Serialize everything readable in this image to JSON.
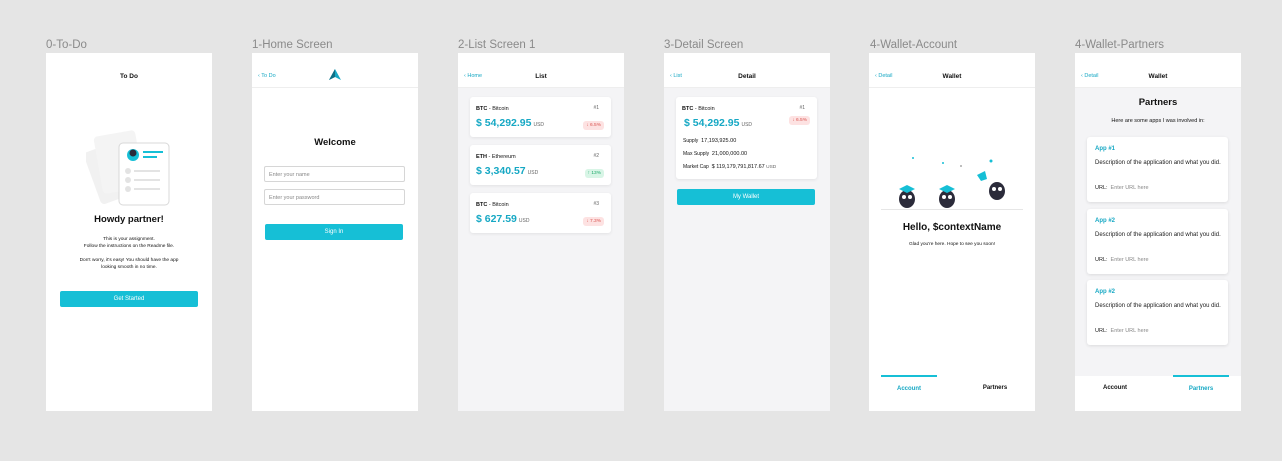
{
  "frames": [
    "0-To-Do",
    "1-Home Screen",
    "2-List Screen 1",
    "3-Detail Screen",
    "4-Wallet-Account",
    "4-Wallet-Partners"
  ],
  "todo": {
    "title": "To Do",
    "heading": "Howdy partner!",
    "line1": "This is your assignment.",
    "line2": "Follow the instructions on the Readme file.",
    "line3": "Don't worry, it's easy! You should have the app",
    "line4": "looking smooth in no time.",
    "button": "Get Started"
  },
  "home": {
    "back": "To Do",
    "heading": "Welcome",
    "name_placeholder": "Enter your name",
    "password_placeholder": "Enter your password",
    "button": "Sign In"
  },
  "list": {
    "back": "Home",
    "title": "List",
    "items": [
      {
        "symbol": "BTC",
        "name": " - Bitcoin",
        "rank": "#1",
        "price": "$ 54,292.95",
        "currency": "USD",
        "change": "↓ 6.5%",
        "direction": "down"
      },
      {
        "symbol": "ETH",
        "name": " - Ethereum",
        "rank": "#2",
        "price": "$ 3,340.57",
        "currency": "USD",
        "change": "↑ 13%",
        "direction": "up"
      },
      {
        "symbol": "BTC",
        "name": " - Bitcoin",
        "rank": "#3",
        "price": "$ 627.59",
        "currency": "USD",
        "change": "↓ 7.3%",
        "direction": "down"
      }
    ]
  },
  "detail": {
    "back": "List",
    "title": "Detail",
    "symbol": "BTC",
    "name": " - Bitcoin",
    "rank": "#1",
    "price": "$ 54,292.95",
    "currency": "USD",
    "change": "↓ 6.5%",
    "supply_label": "Supply",
    "supply_value": "17,193,925.00",
    "max_label": "Max Supply",
    "max_value": "21,000,000.00",
    "cap_label": "Market Cap",
    "cap_value": "$ 119,179,791,817.67",
    "cap_currency": "USD",
    "button": "My Wallet"
  },
  "wallet_account": {
    "back": "Detail",
    "title": "Wallet",
    "heading": "Hello, $contextName",
    "subtitle": "Glad you're here. Hope to see you soon!",
    "tab_account": "Account",
    "tab_partners": "Partners"
  },
  "wallet_partners": {
    "back": "Detail",
    "title": "Wallet",
    "heading": "Partners",
    "intro": "Here are some apps I was involved in:",
    "apps": [
      {
        "name": "App #1",
        "description": "Description of the application and what you did.",
        "url_label": "URL:",
        "url_placeholder": "Enter URL here"
      },
      {
        "name": "App #2",
        "description": "Description of the application and what you did.",
        "url_label": "URL:",
        "url_placeholder": "Enter URL here"
      },
      {
        "name": "App #2",
        "description": "Description of the application and what you did.",
        "url_label": "URL:",
        "url_placeholder": "Enter URL here"
      }
    ],
    "tab_account": "Account",
    "tab_partners": "Partners"
  },
  "colors": {
    "accent": "#16bfd6",
    "accent_text": "#16a8c4",
    "up": "#1ea96a",
    "down": "#d9534f"
  }
}
